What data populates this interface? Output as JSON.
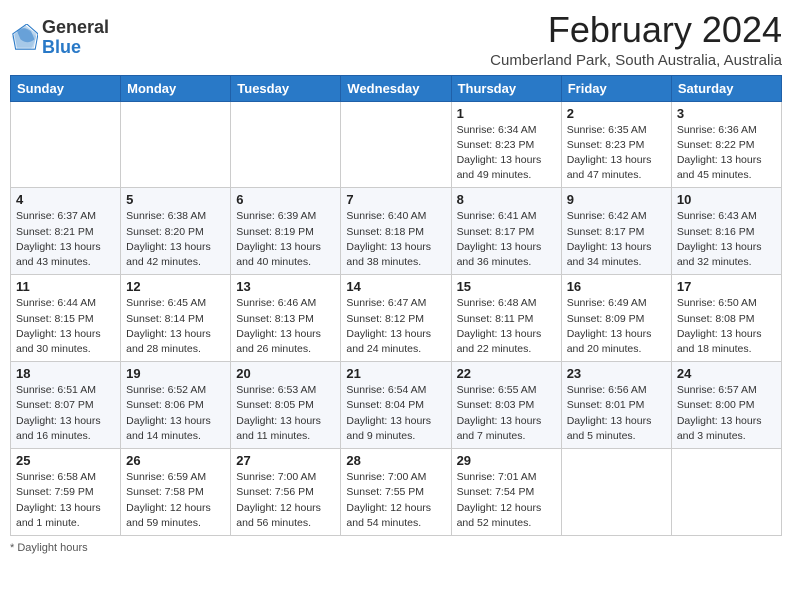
{
  "header": {
    "logo_general": "General",
    "logo_blue": "Blue",
    "month_title": "February 2024",
    "location": "Cumberland Park, South Australia, Australia"
  },
  "days_of_week": [
    "Sunday",
    "Monday",
    "Tuesday",
    "Wednesday",
    "Thursday",
    "Friday",
    "Saturday"
  ],
  "weeks": [
    [
      {
        "day": "",
        "info": ""
      },
      {
        "day": "",
        "info": ""
      },
      {
        "day": "",
        "info": ""
      },
      {
        "day": "",
        "info": ""
      },
      {
        "day": "1",
        "info": "Sunrise: 6:34 AM\nSunset: 8:23 PM\nDaylight: 13 hours\nand 49 minutes."
      },
      {
        "day": "2",
        "info": "Sunrise: 6:35 AM\nSunset: 8:23 PM\nDaylight: 13 hours\nand 47 minutes."
      },
      {
        "day": "3",
        "info": "Sunrise: 6:36 AM\nSunset: 8:22 PM\nDaylight: 13 hours\nand 45 minutes."
      }
    ],
    [
      {
        "day": "4",
        "info": "Sunrise: 6:37 AM\nSunset: 8:21 PM\nDaylight: 13 hours\nand 43 minutes."
      },
      {
        "day": "5",
        "info": "Sunrise: 6:38 AM\nSunset: 8:20 PM\nDaylight: 13 hours\nand 42 minutes."
      },
      {
        "day": "6",
        "info": "Sunrise: 6:39 AM\nSunset: 8:19 PM\nDaylight: 13 hours\nand 40 minutes."
      },
      {
        "day": "7",
        "info": "Sunrise: 6:40 AM\nSunset: 8:18 PM\nDaylight: 13 hours\nand 38 minutes."
      },
      {
        "day": "8",
        "info": "Sunrise: 6:41 AM\nSunset: 8:17 PM\nDaylight: 13 hours\nand 36 minutes."
      },
      {
        "day": "9",
        "info": "Sunrise: 6:42 AM\nSunset: 8:17 PM\nDaylight: 13 hours\nand 34 minutes."
      },
      {
        "day": "10",
        "info": "Sunrise: 6:43 AM\nSunset: 8:16 PM\nDaylight: 13 hours\nand 32 minutes."
      }
    ],
    [
      {
        "day": "11",
        "info": "Sunrise: 6:44 AM\nSunset: 8:15 PM\nDaylight: 13 hours\nand 30 minutes."
      },
      {
        "day": "12",
        "info": "Sunrise: 6:45 AM\nSunset: 8:14 PM\nDaylight: 13 hours\nand 28 minutes."
      },
      {
        "day": "13",
        "info": "Sunrise: 6:46 AM\nSunset: 8:13 PM\nDaylight: 13 hours\nand 26 minutes."
      },
      {
        "day": "14",
        "info": "Sunrise: 6:47 AM\nSunset: 8:12 PM\nDaylight: 13 hours\nand 24 minutes."
      },
      {
        "day": "15",
        "info": "Sunrise: 6:48 AM\nSunset: 8:11 PM\nDaylight: 13 hours\nand 22 minutes."
      },
      {
        "day": "16",
        "info": "Sunrise: 6:49 AM\nSunset: 8:09 PM\nDaylight: 13 hours\nand 20 minutes."
      },
      {
        "day": "17",
        "info": "Sunrise: 6:50 AM\nSunset: 8:08 PM\nDaylight: 13 hours\nand 18 minutes."
      }
    ],
    [
      {
        "day": "18",
        "info": "Sunrise: 6:51 AM\nSunset: 8:07 PM\nDaylight: 13 hours\nand 16 minutes."
      },
      {
        "day": "19",
        "info": "Sunrise: 6:52 AM\nSunset: 8:06 PM\nDaylight: 13 hours\nand 14 minutes."
      },
      {
        "day": "20",
        "info": "Sunrise: 6:53 AM\nSunset: 8:05 PM\nDaylight: 13 hours\nand 11 minutes."
      },
      {
        "day": "21",
        "info": "Sunrise: 6:54 AM\nSunset: 8:04 PM\nDaylight: 13 hours\nand 9 minutes."
      },
      {
        "day": "22",
        "info": "Sunrise: 6:55 AM\nSunset: 8:03 PM\nDaylight: 13 hours\nand 7 minutes."
      },
      {
        "day": "23",
        "info": "Sunrise: 6:56 AM\nSunset: 8:01 PM\nDaylight: 13 hours\nand 5 minutes."
      },
      {
        "day": "24",
        "info": "Sunrise: 6:57 AM\nSunset: 8:00 PM\nDaylight: 13 hours\nand 3 minutes."
      }
    ],
    [
      {
        "day": "25",
        "info": "Sunrise: 6:58 AM\nSunset: 7:59 PM\nDaylight: 13 hours\nand 1 minute."
      },
      {
        "day": "26",
        "info": "Sunrise: 6:59 AM\nSunset: 7:58 PM\nDaylight: 12 hours\nand 59 minutes."
      },
      {
        "day": "27",
        "info": "Sunrise: 7:00 AM\nSunset: 7:56 PM\nDaylight: 12 hours\nand 56 minutes."
      },
      {
        "day": "28",
        "info": "Sunrise: 7:00 AM\nSunset: 7:55 PM\nDaylight: 12 hours\nand 54 minutes."
      },
      {
        "day": "29",
        "info": "Sunrise: 7:01 AM\nSunset: 7:54 PM\nDaylight: 12 hours\nand 52 minutes."
      },
      {
        "day": "",
        "info": ""
      },
      {
        "day": "",
        "info": ""
      }
    ]
  ],
  "footer": {
    "note": "Daylight hours"
  }
}
